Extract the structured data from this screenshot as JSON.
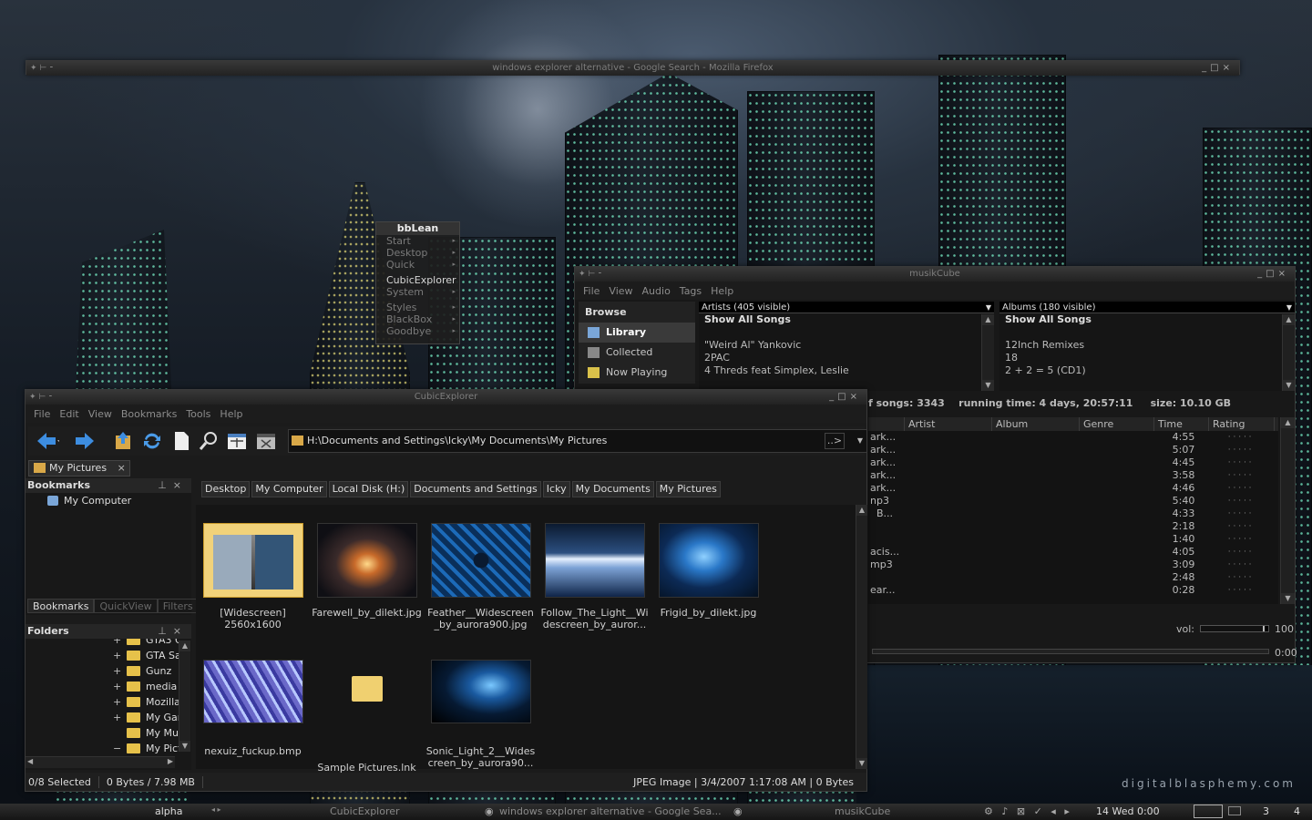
{
  "desktop": {
    "brand": "digitalblasphemy.com"
  },
  "firefox": {
    "title": "windows explorer alternative - Google Search - Mozilla Firefox",
    "left_controls": "✦ ⊢ ⁃",
    "right_controls": "_□×"
  },
  "bblean": {
    "title": "bbLean",
    "items": [
      {
        "label": "Start",
        "on": false
      },
      {
        "label": "Desktop",
        "on": false
      },
      {
        "label": "Quick",
        "on": false
      },
      {
        "label": "CubicExplorer",
        "on": true
      },
      {
        "label": "System",
        "on": false
      },
      {
        "label": "Styles",
        "on": false
      },
      {
        "label": "BlackBox",
        "on": false
      },
      {
        "label": "Goodbye",
        "on": false
      }
    ]
  },
  "musikcube": {
    "title": "musikCube",
    "menu": [
      "File",
      "View",
      "Audio",
      "Tags",
      "Help"
    ],
    "browse_header": "Browse",
    "browse_items": [
      "Library",
      "Collected",
      "Now Playing"
    ],
    "artists": {
      "header": "Artists (405 visible)",
      "show_all": "Show All Songs",
      "items": [
        "\"Weird Al\" Yankovic",
        "2PAC",
        "4 Threds feat Simplex, Leslie"
      ]
    },
    "albums": {
      "header": "Albums (180 visible)",
      "show_all": "Show All Songs",
      "items": [
        "12Inch Remixes",
        "18",
        "2 + 2 = 5 (CD1)"
      ]
    },
    "stats": {
      "songs": "f songs: 3343",
      "running": "running time: 4 days, 20:57:11",
      "size": "size: 10.10 GB"
    },
    "columns": [
      "Artist",
      "Album",
      "Genre",
      "Time",
      "Rating"
    ],
    "rows": [
      {
        "frag": "ark...",
        "time": "4:55"
      },
      {
        "frag": "ark...",
        "time": "5:07"
      },
      {
        "frag": "ark...",
        "time": "4:45"
      },
      {
        "frag": "ark...",
        "time": "3:58"
      },
      {
        "frag": "ark...",
        "time": "4:46"
      },
      {
        "frag": "np3",
        "time": "5:40"
      },
      {
        "frag": "  B...",
        "time": "4:33"
      },
      {
        "frag": "",
        "time": "2:18"
      },
      {
        "frag": "",
        "time": "1:40"
      },
      {
        "frag": "acis...",
        "time": "4:05"
      },
      {
        "frag": "mp3",
        "time": "3:09"
      },
      {
        "frag": "",
        "time": "2:48"
      },
      {
        "frag": "ear...",
        "time": "0:28"
      }
    ],
    "rating_dots": "· · · · ·",
    "vol_label": "vol:",
    "vol_value": "100",
    "volume_fraction": 0.95,
    "position": "0:00"
  },
  "cubic": {
    "title": "CubicExplorer",
    "menu": [
      "File",
      "Edit",
      "View",
      "Bookmarks",
      "Tools",
      "Help"
    ],
    "address": "H:\\Documents and Settings\\Icky\\My Documents\\My Pictures",
    "address_go": "..>",
    "tab": "My Pictures",
    "bookmarks_header": "Bookmarks",
    "bookmark_items": [
      "My Computer"
    ],
    "panel_tabs": [
      "Bookmarks",
      "QuickView",
      "Filters"
    ],
    "folders_header": "Folders",
    "folders": [
      {
        "label": "GTA3 G",
        "sign": "+"
      },
      {
        "label": "GTA Sa",
        "sign": "+"
      },
      {
        "label": "Gunz",
        "sign": "+"
      },
      {
        "label": "media",
        "sign": "+"
      },
      {
        "label": "Mozilla",
        "sign": "+"
      },
      {
        "label": "My Gar",
        "sign": "+"
      },
      {
        "label": "My Mu:",
        "sign": ""
      },
      {
        "label": "My Pict",
        "sign": "−"
      }
    ],
    "breadcrumbs": [
      "Desktop",
      "My Computer",
      "Local Disk (H:)",
      "Documents and Settings",
      "Icky",
      "My Documents",
      "My Pictures"
    ],
    "thumbs": [
      {
        "label": "[Widescreen]\n2560x1600"
      },
      {
        "label": "Farewell_by_dilekt.jpg"
      },
      {
        "label": "Feather__Widescreen\n_by_aurora900.jpg"
      },
      {
        "label": "Follow_The_Light__Wi\ndescreen_by_auror..."
      },
      {
        "label": "Frigid_by_dilekt.jpg"
      },
      {
        "label": "nexuiz_fuckup.bmp"
      },
      {
        "label": "Sample Pictures.lnk"
      },
      {
        "label": "Sonic_Light_2__Wides\ncreen_by_aurora90..."
      }
    ],
    "status": {
      "selected": "0/8 Selected",
      "bytes": "0 Bytes / 7.98 MB",
      "info": "JPEG Image | 3/4/2007 1:17:08 AM | 0 Bytes"
    }
  },
  "taskbar": {
    "workspace": "alpha",
    "tasks": [
      "CubicExplorer",
      "windows explorer alternative - Google Sea...",
      "musikCube"
    ],
    "clock": "14 Wed 0:00",
    "desks": [
      "3",
      "4"
    ]
  }
}
